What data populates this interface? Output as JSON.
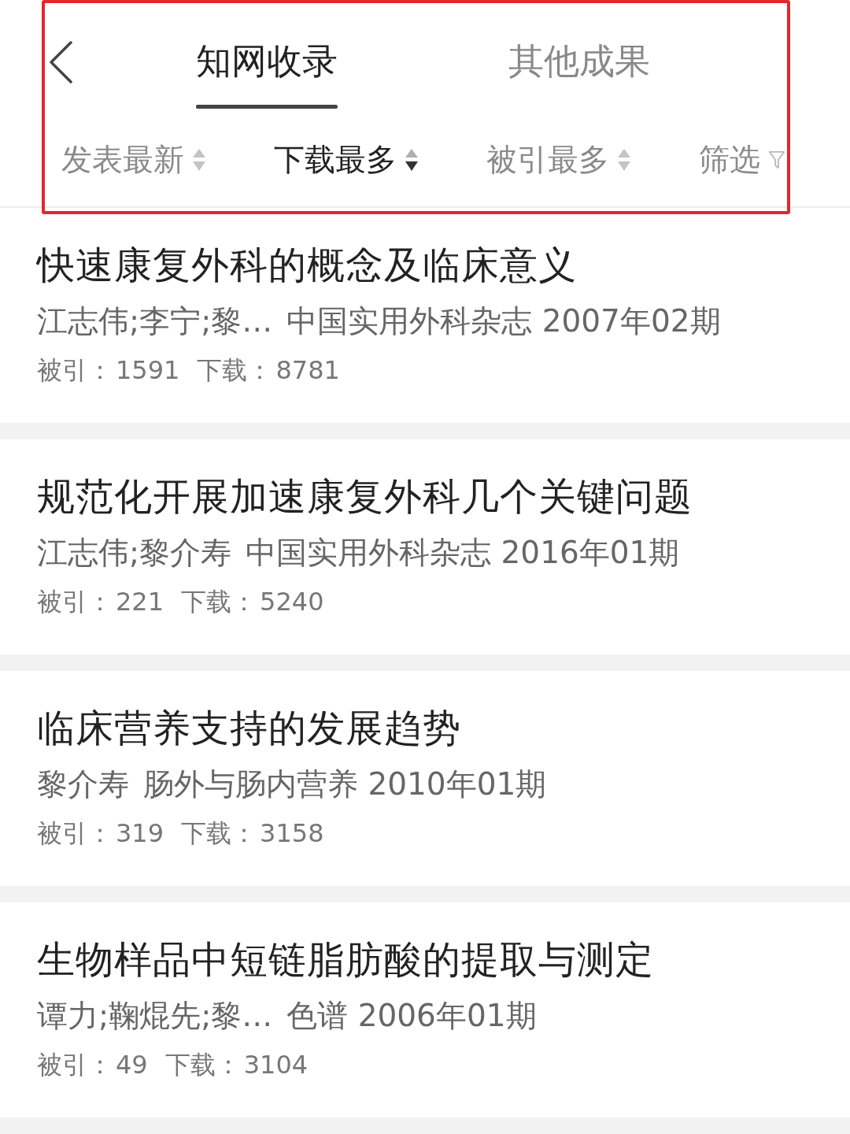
{
  "header": {
    "highlighted": true,
    "tabs": [
      {
        "label": "知网收录",
        "selected": true
      },
      {
        "label": "其他成果",
        "selected": false
      }
    ],
    "sort_options": [
      {
        "label": "发表最新",
        "selected": false
      },
      {
        "label": "下载最多",
        "selected": true
      },
      {
        "label": "被引最多",
        "selected": false
      }
    ],
    "filter": {
      "label": "筛选"
    }
  },
  "articles": [
    {
      "title": "快速康复外科的概念及临床意义",
      "authors": "江志伟;李宁;黎…",
      "source": "中国实用外科杂志 2007年02期",
      "stats": [
        {
          "label": "被引：",
          "value": "1591"
        },
        {
          "label": "下载：",
          "value": "8781"
        }
      ]
    },
    {
      "title": "规范化开展加速康复外科几个关键问题",
      "authors": "江志伟;黎介寿",
      "source": "中国实用外科杂志 2016年01期",
      "stats": [
        {
          "label": "被引：",
          "value": "221"
        },
        {
          "label": "下载：",
          "value": "5240"
        }
      ]
    },
    {
      "title": "临床营养支持的发展趋势",
      "authors": "黎介寿",
      "source": "肠外与肠内营养 2010年01期",
      "stats": [
        {
          "label": "被引：",
          "value": "319"
        },
        {
          "label": "下载：",
          "value": "3158"
        }
      ]
    },
    {
      "title": "生物样品中短链脂肪酸的提取与测定",
      "authors": "谭力;鞠焜先;黎…",
      "source": "色谱 2006年01期",
      "stats": [
        {
          "label": "被引：",
          "value": "49"
        },
        {
          "label": "下载：",
          "value": "3104"
        }
      ]
    }
  ]
}
